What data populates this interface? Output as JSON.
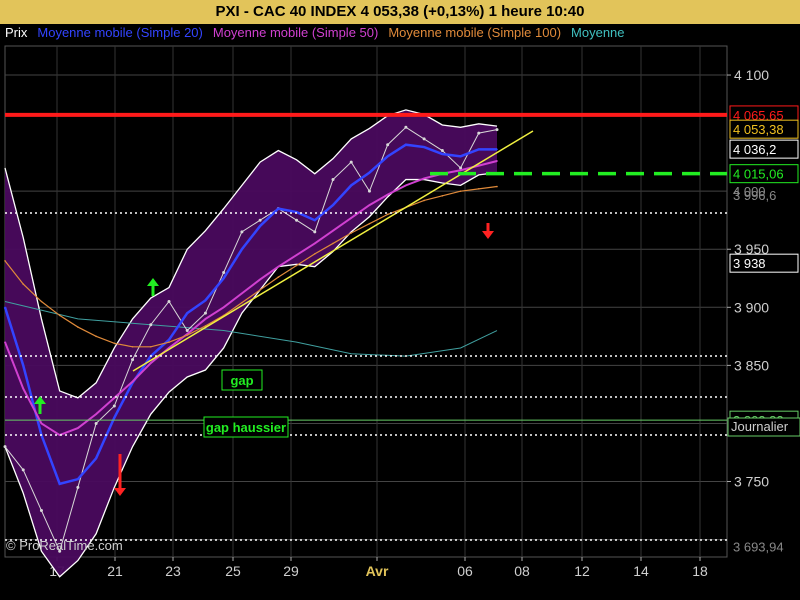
{
  "header": {
    "title": "PXI - CAC 40 INDEX     4 053,38 (+0,13%)     1 heure  10:40"
  },
  "legend": [
    {
      "label": "Prix",
      "color": "#ffffff"
    },
    {
      "label": "Moyenne mobile (Simple 20)",
      "color": "#3344ff"
    },
    {
      "label": "Moyenne mobile (Simple 50)",
      "color": "#d040d0"
    },
    {
      "label": "Moyenne mobile (Simple 100)",
      "color": "#e08a3a"
    },
    {
      "label": "Moyenne",
      "color": "#40c0c0"
    }
  ],
  "watermark": "© ProRealTime.com",
  "chart_data": {
    "type": "line",
    "x_ticks": [
      "17",
      "21",
      "23",
      "25",
      "29",
      "Avr",
      "06",
      "08",
      "12",
      "14",
      "18"
    ],
    "y_ticks": [
      "4 100",
      "3 950",
      "3 900",
      "3 850",
      "3 750"
    ],
    "ylim": [
      3685,
      4125
    ],
    "y_overlap_labels": [
      "4 000",
      "3 996,6",
      "3 693,94"
    ],
    "price_label": "4 053,38",
    "timeframe_label": "Journalier",
    "levels": [
      {
        "value": 4065.65,
        "label": "4 065,65",
        "color": "#ff1a1a"
      },
      {
        "value": 4036.2,
        "label": "4 036,2",
        "color": "#ffffff"
      },
      {
        "value": 4015.06,
        "label": "4 015,06",
        "color": "#22ee22"
      },
      {
        "value": 3938,
        "label": "3 938",
        "color": "#ffffff"
      },
      {
        "value": 3802.82,
        "label": "3 802,82",
        "color": "#66cc66"
      }
    ],
    "annotations": [
      {
        "text": "gap",
        "color": "#22ee22"
      },
      {
        "text": "gap haussier",
        "color": "#22ee22"
      }
    ],
    "series": [
      {
        "name": "Prix",
        "color": "#d8d8d8",
        "values": [
          [
            0,
            3780
          ],
          [
            1,
            3760
          ],
          [
            2,
            3725
          ],
          [
            3,
            3690
          ],
          [
            4,
            3745
          ],
          [
            5,
            3800
          ],
          [
            6,
            3815
          ],
          [
            7,
            3855
          ],
          [
            8,
            3885
          ],
          [
            9,
            3905
          ],
          [
            10,
            3880
          ],
          [
            11,
            3895
          ],
          [
            12,
            3930
          ],
          [
            13,
            3965
          ],
          [
            14,
            3975
          ],
          [
            15,
            3985
          ],
          [
            16,
            3975
          ],
          [
            17,
            3965
          ],
          [
            18,
            4010
          ],
          [
            19,
            4025
          ],
          [
            20,
            4000
          ],
          [
            21,
            4040
          ],
          [
            22,
            4055
          ],
          [
            23,
            4045
          ],
          [
            24,
            4035
          ],
          [
            25,
            4020
          ],
          [
            26,
            4050
          ],
          [
            27,
            4053
          ]
        ]
      },
      {
        "name": "Moyenne mobile (Simple 20)",
        "color": "#3344ff",
        "values": [
          [
            0,
            3900
          ],
          [
            1,
            3850
          ],
          [
            2,
            3790
          ],
          [
            3,
            3748
          ],
          [
            4,
            3752
          ],
          [
            5,
            3770
          ],
          [
            6,
            3805
          ],
          [
            7,
            3835
          ],
          [
            8,
            3858
          ],
          [
            9,
            3872
          ],
          [
            10,
            3895
          ],
          [
            11,
            3906
          ],
          [
            12,
            3925
          ],
          [
            13,
            3950
          ],
          [
            14,
            3970
          ],
          [
            15,
            3985
          ],
          [
            16,
            3982
          ],
          [
            17,
            3975
          ],
          [
            18,
            3988
          ],
          [
            19,
            4005
          ],
          [
            20,
            4016
          ],
          [
            21,
            4030
          ],
          [
            22,
            4040
          ],
          [
            23,
            4038
          ],
          [
            24,
            4032
          ],
          [
            25,
            4030
          ],
          [
            26,
            4036
          ],
          [
            27,
            4036
          ]
        ]
      },
      {
        "name": "Moyenne mobile (Simple 50)",
        "color": "#d040d0",
        "values": [
          [
            0,
            3870
          ],
          [
            1,
            3830
          ],
          [
            2,
            3800
          ],
          [
            3,
            3790
          ],
          [
            4,
            3796
          ],
          [
            5,
            3808
          ],
          [
            6,
            3822
          ],
          [
            7,
            3836
          ],
          [
            8,
            3852
          ],
          [
            9,
            3865
          ],
          [
            10,
            3877
          ],
          [
            11,
            3890
          ],
          [
            12,
            3900
          ],
          [
            13,
            3912
          ],
          [
            14,
            3924
          ],
          [
            15,
            3935
          ],
          [
            16,
            3945
          ],
          [
            17,
            3955
          ],
          [
            18,
            3966
          ],
          [
            19,
            3977
          ],
          [
            20,
            3988
          ],
          [
            21,
            3997
          ],
          [
            22,
            4005
          ],
          [
            23,
            4011
          ],
          [
            24,
            4015
          ],
          [
            25,
            4018
          ],
          [
            26,
            4022
          ],
          [
            27,
            4026
          ]
        ]
      },
      {
        "name": "Moyenne mobile (Simple 100)",
        "color": "#e08a3a",
        "values": [
          [
            0,
            3940
          ],
          [
            1,
            3920
          ],
          [
            2,
            3905
          ],
          [
            3,
            3893
          ],
          [
            4,
            3883
          ],
          [
            5,
            3875
          ],
          [
            6,
            3869
          ],
          [
            7,
            3866
          ],
          [
            8,
            3866
          ],
          [
            9,
            3870
          ],
          [
            10,
            3876
          ],
          [
            11,
            3884
          ],
          [
            12,
            3893
          ],
          [
            13,
            3904
          ],
          [
            14,
            3915
          ],
          [
            15,
            3926
          ],
          [
            16,
            3936
          ],
          [
            17,
            3946
          ],
          [
            18,
            3955
          ],
          [
            19,
            3964
          ],
          [
            20,
            3972
          ],
          [
            21,
            3980
          ],
          [
            22,
            3986
          ],
          [
            23,
            3992
          ],
          [
            24,
            3996
          ],
          [
            25,
            4000
          ],
          [
            26,
            4002
          ],
          [
            27,
            4004
          ]
        ]
      }
    ]
  }
}
